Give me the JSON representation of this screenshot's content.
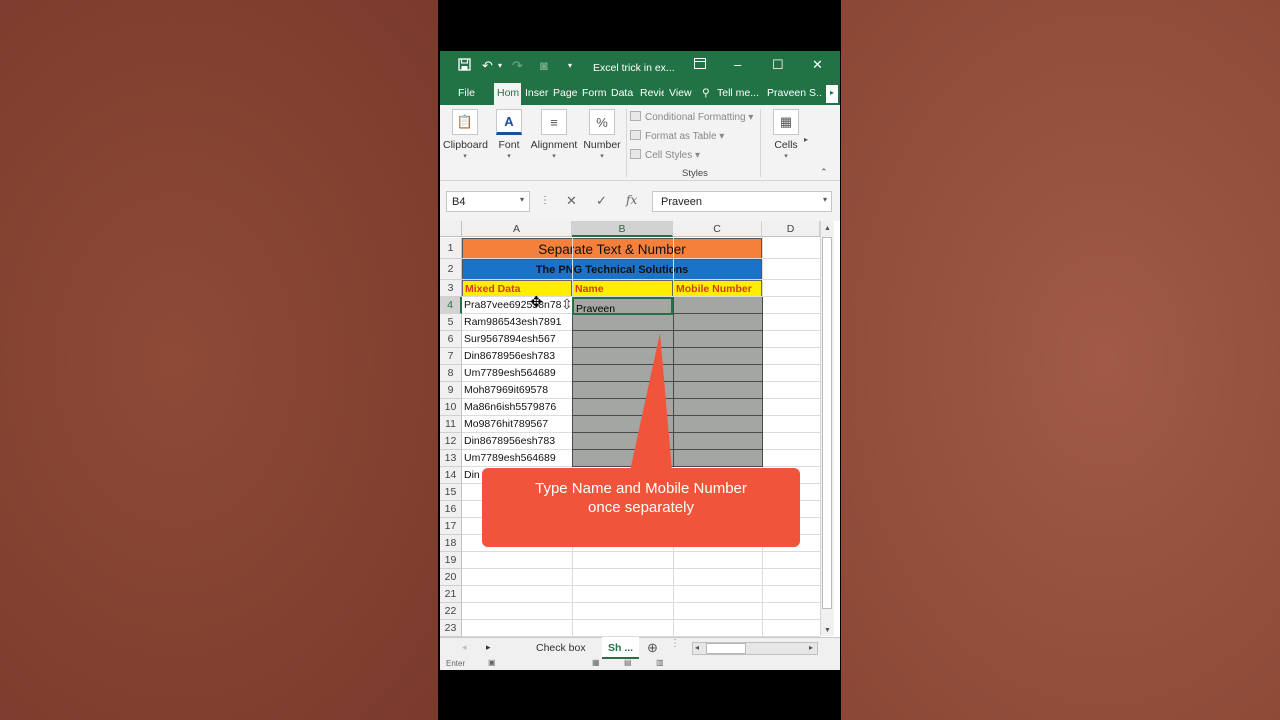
{
  "window": {
    "title": "Excel trick in ex...",
    "qat": {
      "save_icon": "save-icon",
      "undo_icon": "undo-icon",
      "redo_icon": "redo-icon",
      "camera_icon": "camera-icon"
    }
  },
  "ribbon_tabs": [
    "File",
    "Hom",
    "Inser",
    "Page",
    "Form",
    "Data",
    "Revie",
    "View",
    "Tell me...",
    "Praveen S..."
  ],
  "ribbon": {
    "clipboard": "Clipboard",
    "font": "Font",
    "alignment": "Alignment",
    "number": "Number",
    "conditional_formatting": "Conditional Formatting",
    "format_as_table": "Format as Table",
    "cell_styles": "Cell Styles",
    "styles": "Styles",
    "cells": "Cells"
  },
  "formula_bar": {
    "name_box": "B4",
    "value": "Praveen"
  },
  "columns": [
    "A",
    "B",
    "C",
    "D"
  ],
  "rows": [
    "1",
    "2",
    "3",
    "4",
    "5",
    "6",
    "7",
    "8",
    "9",
    "10",
    "11",
    "12",
    "13",
    "14",
    "15",
    "16",
    "17",
    "18",
    "19",
    "20",
    "21",
    "22",
    "23"
  ],
  "sheet": {
    "title": "Separate Text & Number",
    "subtitle": "The PNG Technical Solutions",
    "headers": {
      "a": "Mixed Data",
      "b": "Name",
      "c": "Mobile Number"
    },
    "mixed_data": [
      "Pra87vee692558n78",
      "Ram986543esh7891",
      "Sur9567894esh567",
      "Din8678956esh783",
      "Um7789esh564689",
      "Moh87969it69578",
      "Ma86n6ish5579876",
      "Mo9876hit789567",
      "Din8678956esh783",
      "Um7789esh564689",
      "Din"
    ],
    "b4": "Praveen"
  },
  "callout": {
    "line1": "Type Name and Mobile Number",
    "line2": "once separately"
  },
  "sheet_tabs": [
    "Check box",
    "Sh ..."
  ],
  "status": "Enter",
  "colors": {
    "excel_green": "#217346",
    "orange": "#f4803c",
    "blue": "#1a73c8",
    "yellow": "#ffee00",
    "callout": "#f0553c"
  }
}
